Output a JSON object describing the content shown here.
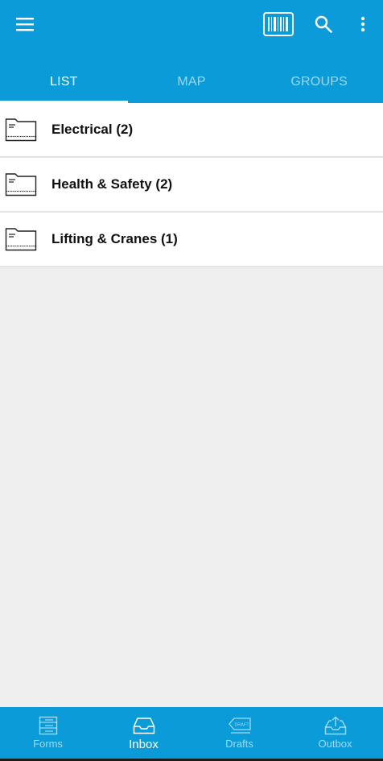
{
  "appbar": {
    "menu_icon": "hamburger-menu-icon",
    "barcode_icon": "barcode-scanner-icon",
    "search_icon": "search-icon",
    "more_icon": "more-vertical-icon"
  },
  "tabs": [
    {
      "label": "LIST",
      "active": true
    },
    {
      "label": "MAP",
      "active": false
    },
    {
      "label": "GROUPS",
      "active": false
    }
  ],
  "list": [
    {
      "label": "Electrical (2)",
      "icon": "folder-icon"
    },
    {
      "label": "Health & Safety (2)",
      "icon": "folder-icon"
    },
    {
      "label": "Lifting & Cranes (1)",
      "icon": "folder-icon"
    }
  ],
  "bottom_nav": [
    {
      "label": "Forms",
      "icon": "forms-icon",
      "active": false
    },
    {
      "label": "Inbox",
      "icon": "inbox-icon",
      "active": true
    },
    {
      "label": "Drafts",
      "icon": "drafts-icon",
      "active": false
    },
    {
      "label": "Outbox",
      "icon": "outbox-icon",
      "active": false
    }
  ],
  "colors": {
    "primary": "#0a9bd8",
    "background": "#efefef",
    "list_background": "#ffffff"
  }
}
